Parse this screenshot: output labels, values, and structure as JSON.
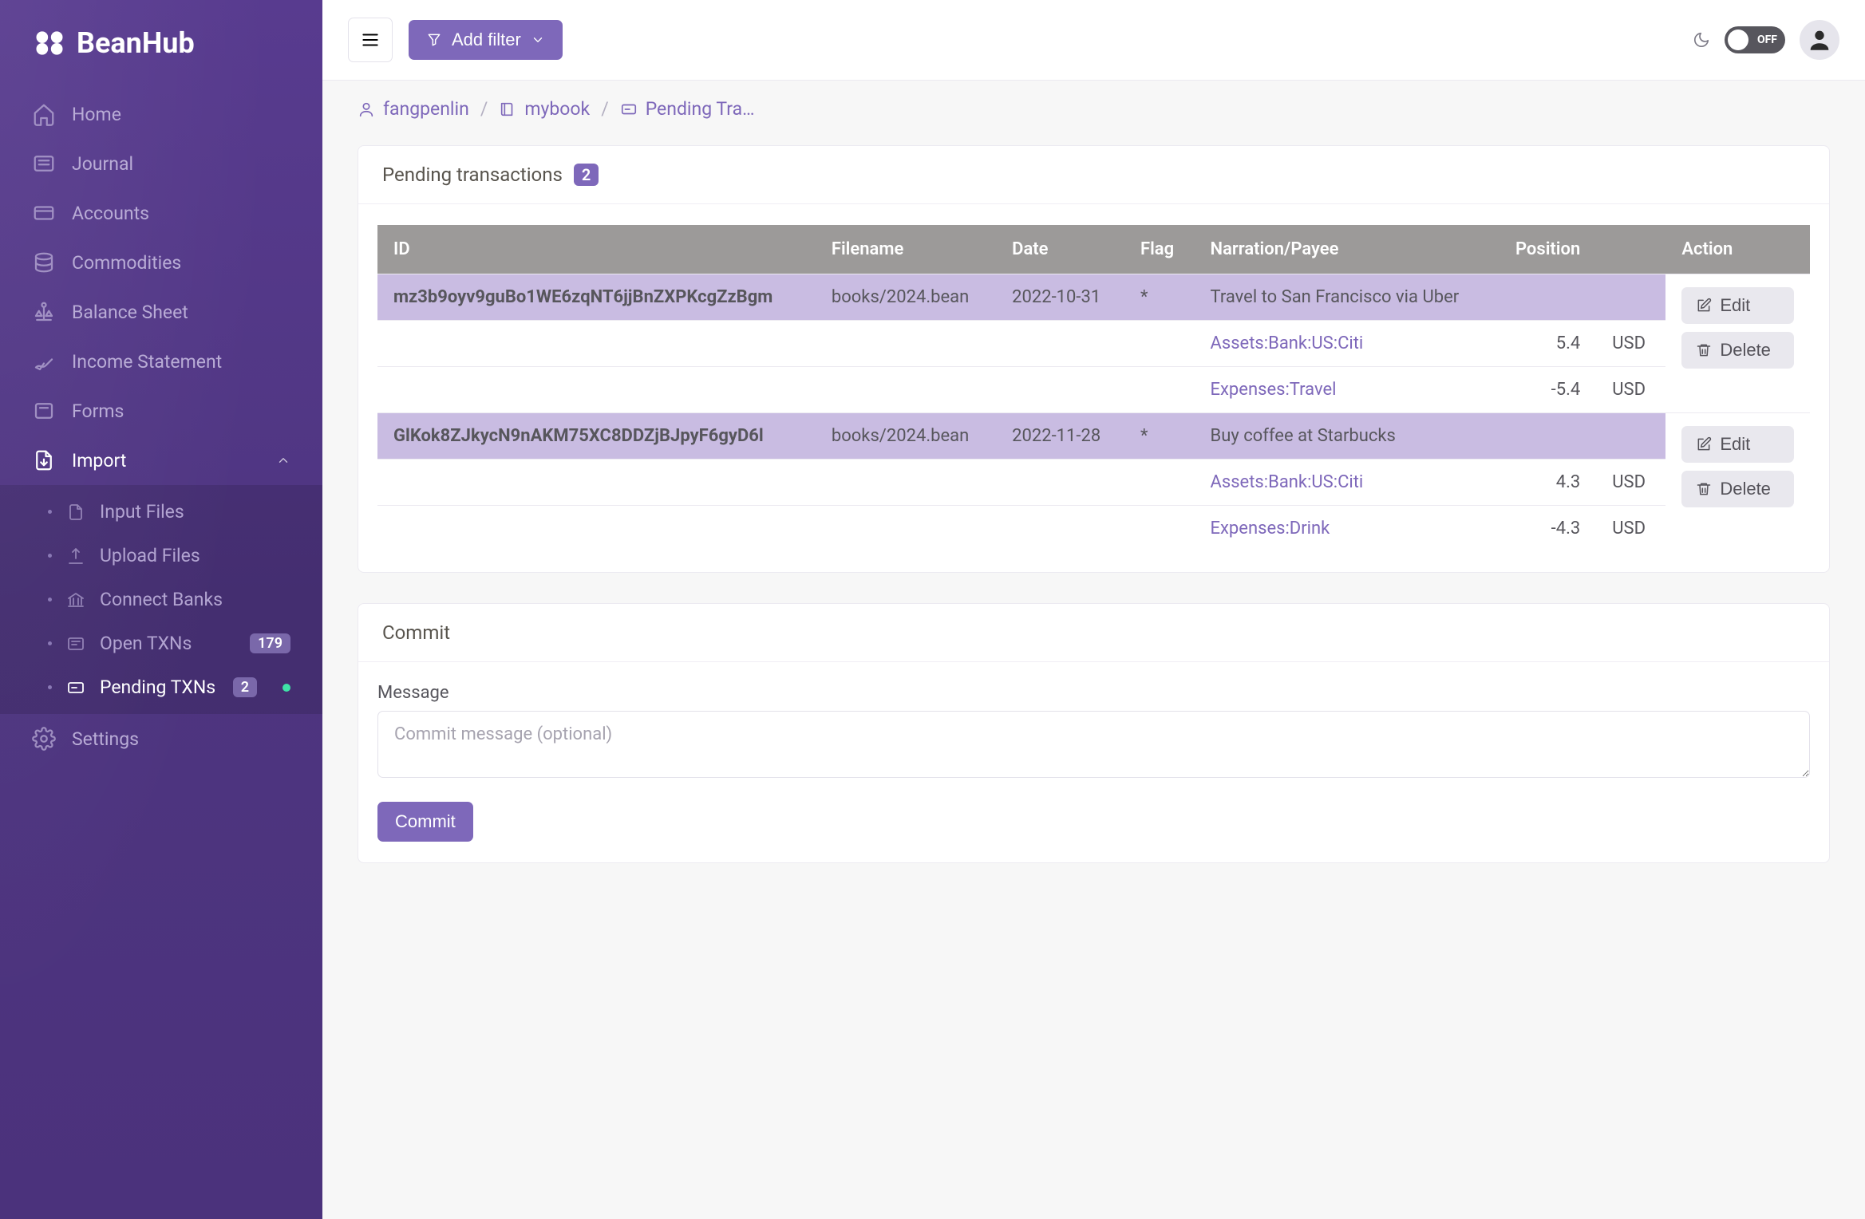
{
  "brand": "BeanHub",
  "sidebar": {
    "items": [
      {
        "label": "Home"
      },
      {
        "label": "Journal"
      },
      {
        "label": "Accounts"
      },
      {
        "label": "Commodities"
      },
      {
        "label": "Balance Sheet"
      },
      {
        "label": "Income Statement"
      },
      {
        "label": "Forms"
      },
      {
        "label": "Import"
      }
    ],
    "import_children": [
      {
        "label": "Input Files"
      },
      {
        "label": "Upload Files"
      },
      {
        "label": "Connect Banks"
      },
      {
        "label": "Open TXNs",
        "badge": "179"
      },
      {
        "label": "Pending TXNs",
        "badge": "2"
      }
    ],
    "settings": {
      "label": "Settings"
    }
  },
  "topbar": {
    "add_filter": "Add filter",
    "toggle_label": "OFF"
  },
  "breadcrumb": {
    "user": "fangpenlin",
    "book": "mybook",
    "page": "Pending Tra…"
  },
  "pending": {
    "title": "Pending transactions",
    "count": "2",
    "columns": [
      "ID",
      "Filename",
      "Date",
      "Flag",
      "Narration/Payee",
      "Position",
      "",
      "Action"
    ],
    "rows": [
      {
        "id": "mz3b9oyv9guBo1WE6zqNT6jjBnZXPKcgZzBgm",
        "filename": "books/2024.bean",
        "date": "2022-10-31",
        "flag": "*",
        "narration": "Travel to San Francisco via Uber",
        "edit": "Edit",
        "delete": "Delete",
        "postings": [
          {
            "account": "Assets:Bank:US:Citi",
            "amount": "5.4",
            "currency": "USD"
          },
          {
            "account": "Expenses:Travel",
            "amount": "-5.4",
            "currency": "USD"
          }
        ]
      },
      {
        "id": "GlKok8ZJkycN9nAKM75XC8DDZjBJpyF6gyD6l",
        "filename": "books/2024.bean",
        "date": "2022-11-28",
        "flag": "*",
        "narration": "Buy coffee at Starbucks",
        "edit": "Edit",
        "delete": "Delete",
        "postings": [
          {
            "account": "Assets:Bank:US:Citi",
            "amount": "4.3",
            "currency": "USD"
          },
          {
            "account": "Expenses:Drink",
            "amount": "-4.3",
            "currency": "USD"
          }
        ]
      }
    ]
  },
  "commit": {
    "title": "Commit",
    "message_label": "Message",
    "placeholder": "Commit message (optional)",
    "button": "Commit"
  }
}
